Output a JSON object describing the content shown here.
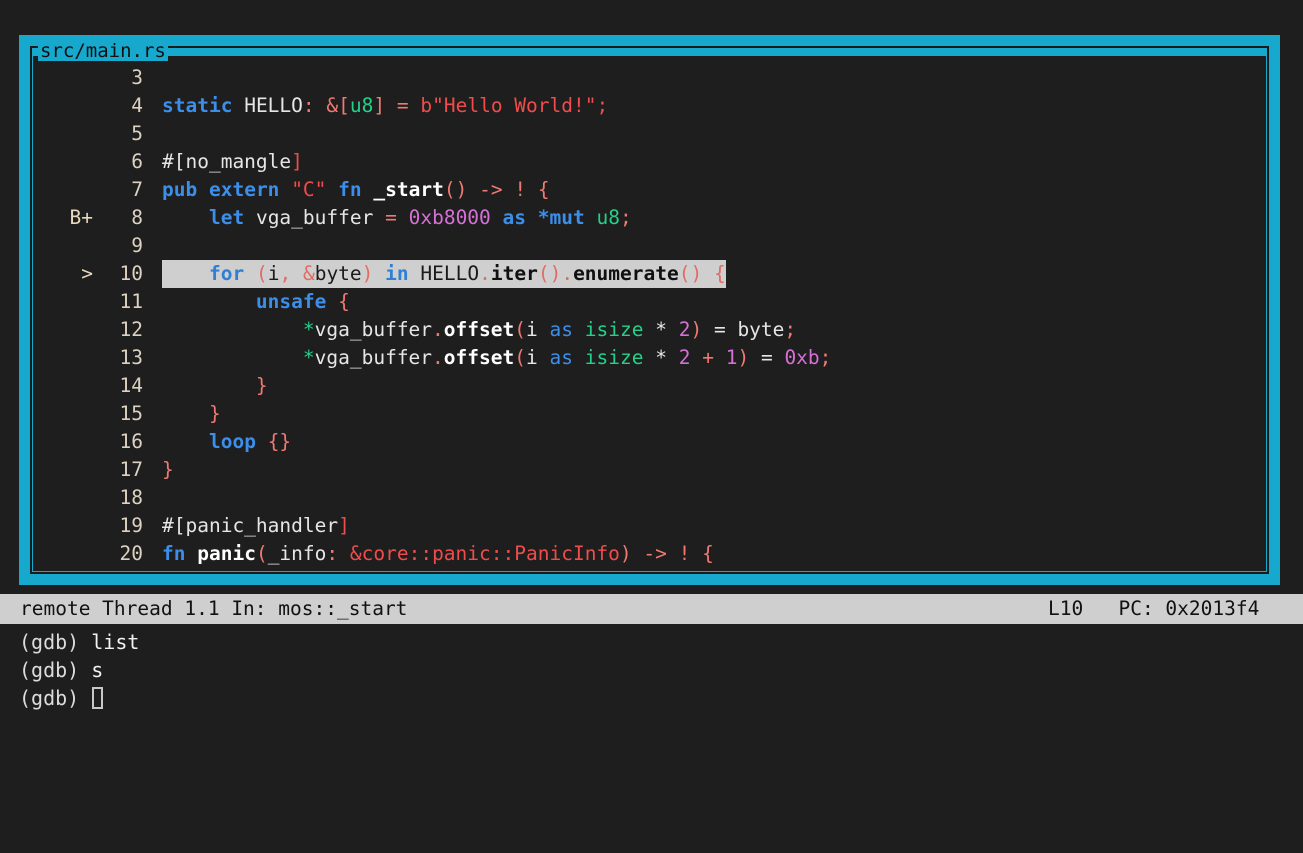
{
  "window": {
    "title": "src/main.rs",
    "border_color": "#16a9cd",
    "background": "#1e1e1e"
  },
  "source": {
    "lines": [
      {
        "marker": "",
        "num": "3",
        "tokens": []
      },
      {
        "marker": "",
        "num": "4",
        "tokens": [
          {
            "t": "static",
            "c": "kw"
          },
          {
            "t": " ",
            "c": "id"
          },
          {
            "t": "HELLO",
            "c": "id"
          },
          {
            "t": ":",
            "c": "pun"
          },
          {
            "t": " ",
            "c": "id"
          },
          {
            "t": "&[",
            "c": "pun"
          },
          {
            "t": "u8",
            "c": "ty"
          },
          {
            "t": "]",
            "c": "pun"
          },
          {
            "t": " ",
            "c": "id"
          },
          {
            "t": "=",
            "c": "pun"
          },
          {
            "t": " ",
            "c": "id"
          },
          {
            "t": "b\"Hello World!\";",
            "c": "str"
          }
        ]
      },
      {
        "marker": "",
        "num": "5",
        "tokens": []
      },
      {
        "marker": "",
        "num": "6",
        "tokens": [
          {
            "t": "#[",
            "c": "attr"
          },
          {
            "t": "no_mangle",
            "c": "attr"
          },
          {
            "t": "]",
            "c": "str"
          }
        ]
      },
      {
        "marker": "",
        "num": "7",
        "tokens": [
          {
            "t": "pub",
            "c": "kw"
          },
          {
            "t": " ",
            "c": "id"
          },
          {
            "t": "extern",
            "c": "kw"
          },
          {
            "t": " ",
            "c": "id"
          },
          {
            "t": "\"C\"",
            "c": "str"
          },
          {
            "t": " ",
            "c": "id"
          },
          {
            "t": "fn",
            "c": "kw"
          },
          {
            "t": " ",
            "c": "id"
          },
          {
            "t": "_start",
            "c": "fnb"
          },
          {
            "t": "()",
            "c": "pun"
          },
          {
            "t": " ",
            "c": "id"
          },
          {
            "t": "->",
            "c": "pun"
          },
          {
            "t": " ",
            "c": "id"
          },
          {
            "t": "!",
            "c": "pun"
          },
          {
            "t": " ",
            "c": "id"
          },
          {
            "t": "{",
            "c": "pun"
          }
        ]
      },
      {
        "marker": "B+",
        "num": "8",
        "tokens": [
          {
            "t": "    ",
            "c": "id"
          },
          {
            "t": "let",
            "c": "kw"
          },
          {
            "t": " ",
            "c": "id"
          },
          {
            "t": "vga_buffer",
            "c": "id"
          },
          {
            "t": " ",
            "c": "id"
          },
          {
            "t": "=",
            "c": "pun"
          },
          {
            "t": " ",
            "c": "id"
          },
          {
            "t": "0xb8000",
            "c": "num"
          },
          {
            "t": " ",
            "c": "id"
          },
          {
            "t": "as",
            "c": "kw"
          },
          {
            "t": " ",
            "c": "id"
          },
          {
            "t": "*mut",
            "c": "kw"
          },
          {
            "t": " ",
            "c": "id"
          },
          {
            "t": "u8",
            "c": "ty"
          },
          {
            "t": ";",
            "c": "pun"
          }
        ]
      },
      {
        "marker": "",
        "num": "9",
        "tokens": []
      },
      {
        "marker": ">",
        "num": "10",
        "current": true,
        "tokens": [
          {
            "t": "    ",
            "c": "id"
          },
          {
            "t": "for",
            "c": "kw"
          },
          {
            "t": " ",
            "c": "id"
          },
          {
            "t": "(",
            "c": "pun"
          },
          {
            "t": "i",
            "c": "id"
          },
          {
            "t": ",",
            "c": "pun"
          },
          {
            "t": " ",
            "c": "id"
          },
          {
            "t": "&",
            "c": "pun"
          },
          {
            "t": "byte",
            "c": "id"
          },
          {
            "t": ")",
            "c": "pun"
          },
          {
            "t": " ",
            "c": "id"
          },
          {
            "t": "in",
            "c": "kw"
          },
          {
            "t": " ",
            "c": "id"
          },
          {
            "t": "HELLO",
            "c": "id"
          },
          {
            "t": ".",
            "c": "pun"
          },
          {
            "t": "iter",
            "c": "fnb"
          },
          {
            "t": "()",
            "c": "pun"
          },
          {
            "t": ".",
            "c": "pun"
          },
          {
            "t": "enumerate",
            "c": "fnb"
          },
          {
            "t": "()",
            "c": "pun"
          },
          {
            "t": " ",
            "c": "id"
          },
          {
            "t": "{",
            "c": "pun"
          }
        ]
      },
      {
        "marker": "",
        "num": "11",
        "tokens": [
          {
            "t": "        ",
            "c": "id"
          },
          {
            "t": "unsafe",
            "c": "kw"
          },
          {
            "t": " ",
            "c": "id"
          },
          {
            "t": "{",
            "c": "pun"
          }
        ]
      },
      {
        "marker": "",
        "num": "12",
        "tokens": [
          {
            "t": "            ",
            "c": "id"
          },
          {
            "t": "*",
            "c": "ty"
          },
          {
            "t": "vga_buffer",
            "c": "id"
          },
          {
            "t": ".",
            "c": "pun"
          },
          {
            "t": "offset",
            "c": "fnb"
          },
          {
            "t": "(",
            "c": "pun"
          },
          {
            "t": "i",
            "c": "id"
          },
          {
            "t": " ",
            "c": "id"
          },
          {
            "t": "as",
            "c": "kw2"
          },
          {
            "t": " ",
            "c": "id"
          },
          {
            "t": "isize",
            "c": "ty"
          },
          {
            "t": " ",
            "c": "id"
          },
          {
            "t": "*",
            "c": "id"
          },
          {
            "t": " ",
            "c": "id"
          },
          {
            "t": "2",
            "c": "num"
          },
          {
            "t": ")",
            "c": "pun"
          },
          {
            "t": " ",
            "c": "id"
          },
          {
            "t": "=",
            "c": "id"
          },
          {
            "t": " ",
            "c": "id"
          },
          {
            "t": "byte",
            "c": "id"
          },
          {
            "t": ";",
            "c": "pun"
          }
        ]
      },
      {
        "marker": "",
        "num": "13",
        "tokens": [
          {
            "t": "            ",
            "c": "id"
          },
          {
            "t": "*",
            "c": "ty"
          },
          {
            "t": "vga_buffer",
            "c": "id"
          },
          {
            "t": ".",
            "c": "pun"
          },
          {
            "t": "offset",
            "c": "fnb"
          },
          {
            "t": "(",
            "c": "pun"
          },
          {
            "t": "i",
            "c": "id"
          },
          {
            "t": " ",
            "c": "id"
          },
          {
            "t": "as",
            "c": "kw2"
          },
          {
            "t": " ",
            "c": "id"
          },
          {
            "t": "isize",
            "c": "ty"
          },
          {
            "t": " ",
            "c": "id"
          },
          {
            "t": "*",
            "c": "id"
          },
          {
            "t": " ",
            "c": "id"
          },
          {
            "t": "2",
            "c": "num"
          },
          {
            "t": " ",
            "c": "id"
          },
          {
            "t": "+",
            "c": "pun"
          },
          {
            "t": " ",
            "c": "id"
          },
          {
            "t": "1",
            "c": "num"
          },
          {
            "t": ")",
            "c": "pun"
          },
          {
            "t": " ",
            "c": "id"
          },
          {
            "t": "=",
            "c": "id"
          },
          {
            "t": " ",
            "c": "id"
          },
          {
            "t": "0xb",
            "c": "num"
          },
          {
            "t": ";",
            "c": "pun"
          }
        ]
      },
      {
        "marker": "",
        "num": "14",
        "tokens": [
          {
            "t": "        ",
            "c": "id"
          },
          {
            "t": "}",
            "c": "pun"
          }
        ]
      },
      {
        "marker": "",
        "num": "15",
        "tokens": [
          {
            "t": "    ",
            "c": "id"
          },
          {
            "t": "}",
            "c": "pun"
          }
        ]
      },
      {
        "marker": "",
        "num": "16",
        "tokens": [
          {
            "t": "    ",
            "c": "id"
          },
          {
            "t": "loop",
            "c": "kw"
          },
          {
            "t": " ",
            "c": "id"
          },
          {
            "t": "{}",
            "c": "pun"
          }
        ]
      },
      {
        "marker": "",
        "num": "17",
        "tokens": [
          {
            "t": "}",
            "c": "pun"
          }
        ]
      },
      {
        "marker": "",
        "num": "18",
        "tokens": []
      },
      {
        "marker": "",
        "num": "19",
        "tokens": [
          {
            "t": "#[",
            "c": "attr"
          },
          {
            "t": "panic_handler",
            "c": "attr"
          },
          {
            "t": "]",
            "c": "str"
          }
        ]
      },
      {
        "marker": "",
        "num": "20",
        "tokens": [
          {
            "t": "fn",
            "c": "kw"
          },
          {
            "t": " ",
            "c": "id"
          },
          {
            "t": "panic",
            "c": "fnb"
          },
          {
            "t": "(",
            "c": "pun"
          },
          {
            "t": "_info",
            "c": "id"
          },
          {
            "t": ":",
            "c": "pun"
          },
          {
            "t": " ",
            "c": "id"
          },
          {
            "t": "&core::panic::PanicInfo",
            "c": "str"
          },
          {
            "t": ")",
            "c": "pun"
          },
          {
            "t": " ",
            "c": "id"
          },
          {
            "t": "->",
            "c": "pun"
          },
          {
            "t": " ",
            "c": "id"
          },
          {
            "t": "!",
            "c": "pun"
          },
          {
            "t": " ",
            "c": "id"
          },
          {
            "t": "{",
            "c": "pun"
          }
        ]
      }
    ]
  },
  "status": {
    "left": "remote Thread 1.1 In: mos::_start",
    "line_indicator": "L10",
    "pc": "PC: 0x2013f4"
  },
  "console": {
    "lines": [
      {
        "prompt": "(gdb) ",
        "cmd": "list",
        "cursor": false
      },
      {
        "prompt": "(gdb) ",
        "cmd": "s",
        "cursor": false
      },
      {
        "prompt": "(gdb) ",
        "cmd": "",
        "cursor": true
      }
    ]
  }
}
